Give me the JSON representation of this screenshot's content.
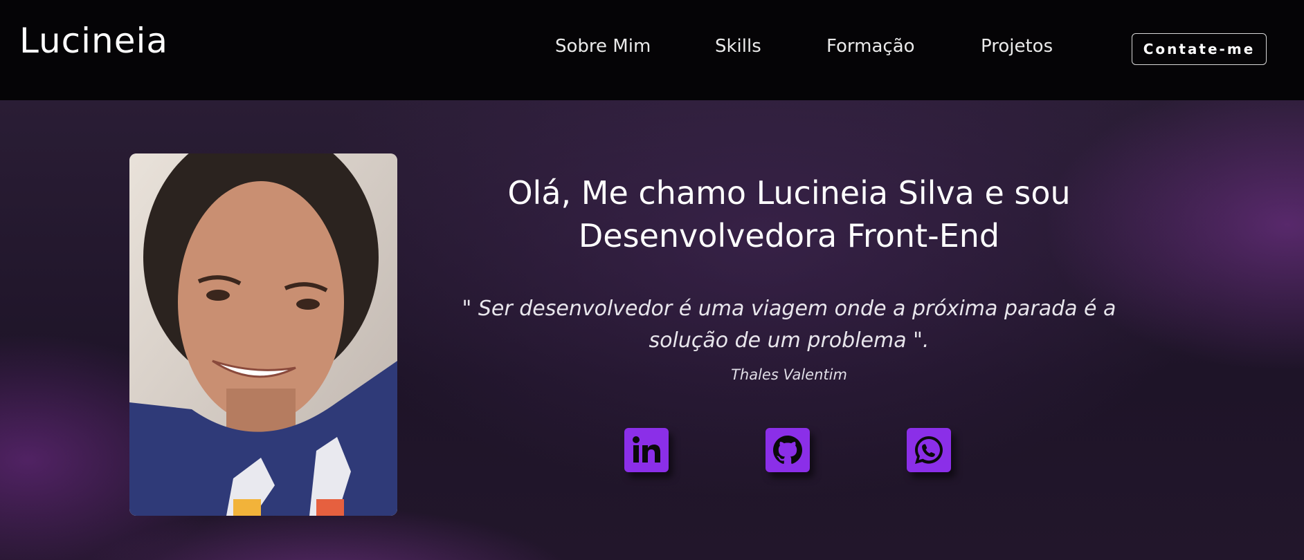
{
  "header": {
    "logo": "Lucineia",
    "nav": [
      {
        "label": "Sobre Mim"
      },
      {
        "label": "Skills"
      },
      {
        "label": "Formação"
      },
      {
        "label": "Projetos"
      }
    ],
    "contact_button": "Contate-me"
  },
  "hero": {
    "photo_icon": "profile-photo",
    "headline_line1": "Olá, Me chamo Lucineia Silva e sou",
    "headline_line2": "Desenvolvedora Front-End",
    "quote_line1": "\" Ser desenvolvedor é uma viagem onde a próxima parada é a",
    "quote_line2": "solução de um problema \".",
    "quote_author": "Thales Valentim",
    "social": [
      {
        "icon": "linkedin-icon"
      },
      {
        "icon": "github-icon"
      },
      {
        "icon": "whatsapp-icon"
      }
    ]
  },
  "colors": {
    "header_bg": "#050406",
    "hero_bg": "#1e1428",
    "accent": "#8b2fe8",
    "text": "#ffffff"
  }
}
